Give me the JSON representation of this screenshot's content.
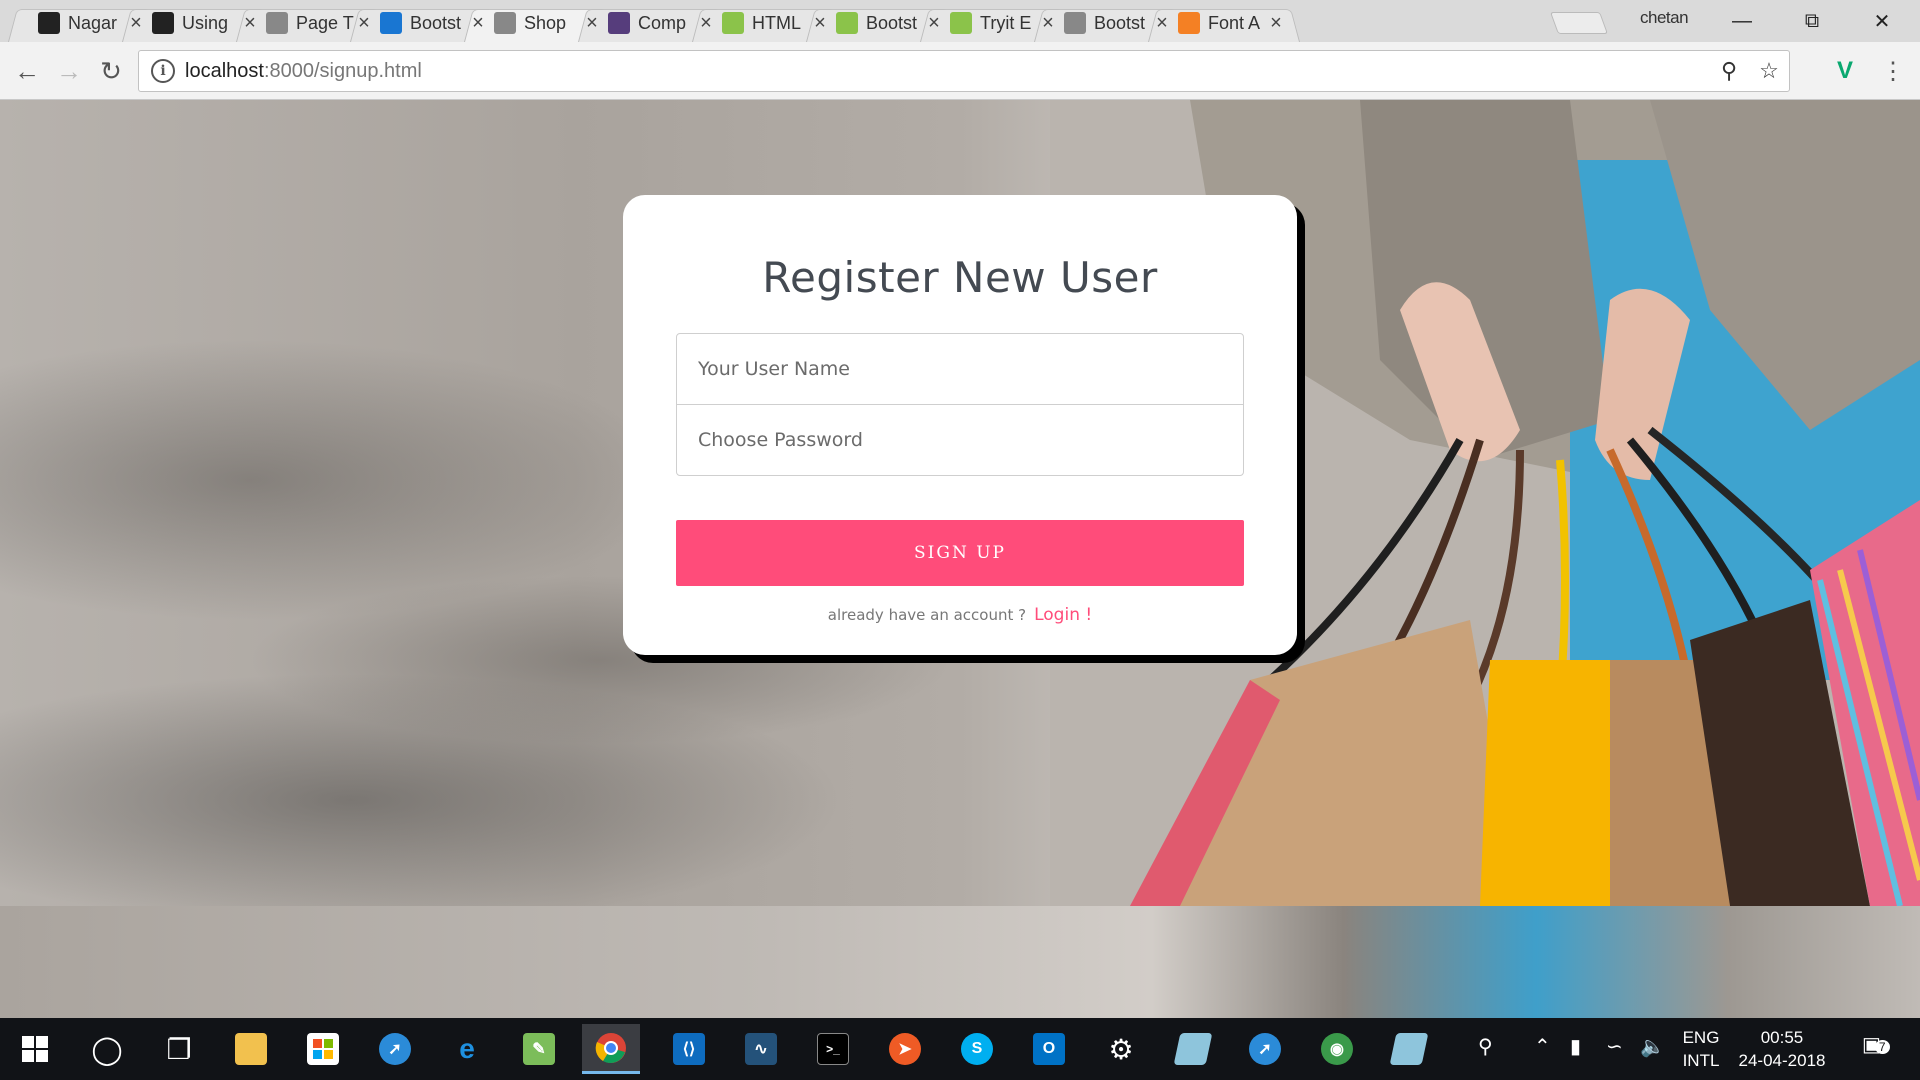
{
  "browser": {
    "tabs": [
      {
        "title": "Nagar",
        "icon": "github-icon",
        "color": "#222222"
      },
      {
        "title": "Using",
        "icon": "ex-icon",
        "color": "#222222"
      },
      {
        "title": "Page T",
        "icon": "page-icon",
        "color": "#888888"
      },
      {
        "title": "Bootst",
        "icon": "bootstrap-blue-icon",
        "color": "#1976d2"
      },
      {
        "title": "Shop",
        "icon": "page-icon",
        "color": "#888888",
        "active": true
      },
      {
        "title": "Comp",
        "icon": "bootstrap-icon",
        "color": "#563d7c"
      },
      {
        "title": "HTML",
        "icon": "w3-icon",
        "color": "#8bc34a"
      },
      {
        "title": "Bootst",
        "icon": "w3-icon",
        "color": "#8bc34a"
      },
      {
        "title": "Tryit E",
        "icon": "w3-icon",
        "color": "#8bc34a"
      },
      {
        "title": "Bootst",
        "icon": "page-icon",
        "color": "#888888"
      },
      {
        "title": "Font A",
        "icon": "stackoverflow-icon",
        "color": "#f48024"
      }
    ],
    "profile_name": "chetan",
    "address": {
      "host": "localhost",
      "rest": ":8000/signup.html"
    }
  },
  "page": {
    "title": "Register New User",
    "username_placeholder": "Your User Name",
    "password_placeholder": "Choose Password",
    "signup_label": "SIGN UP",
    "already_text": "already have an account ?",
    "login_link": "Login !",
    "accent_color": "#ff4c7a"
  },
  "taskbar": {
    "lang_top": "ENG",
    "lang_bottom": "INTL",
    "time": "00:55",
    "date": "24-04-2018",
    "notification_count": "7"
  }
}
